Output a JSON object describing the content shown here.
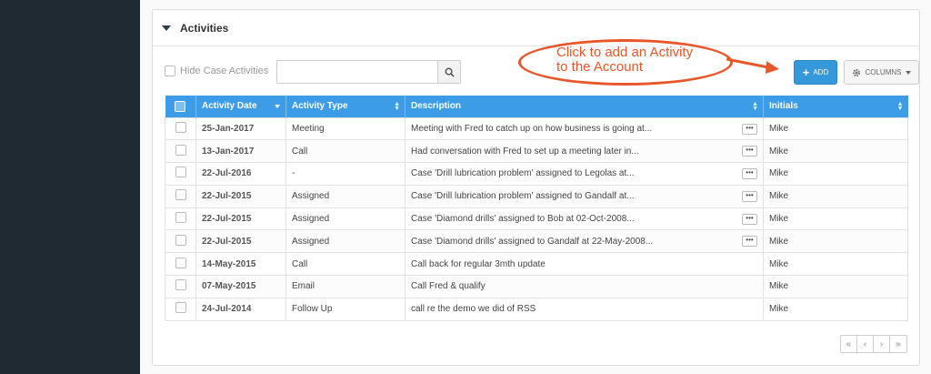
{
  "panel": {
    "title": "Activities"
  },
  "toolbar": {
    "hide_label": "Hide Case Activities",
    "search_placeholder": "",
    "add_label": "ADD",
    "columns_label": "COLUMNS"
  },
  "annotation": {
    "line1": "Click to add an Activity",
    "line2": "to the Account"
  },
  "table": {
    "headers": [
      "Activity Date",
      "Activity Type",
      "Description",
      "Initials"
    ],
    "rows": [
      {
        "date": "25-Jan-2017",
        "type": "Meeting",
        "description": "Meeting with Fred to catch up on how business is going at...",
        "initials": "Mike",
        "more": true
      },
      {
        "date": "13-Jan-2017",
        "type": "Call",
        "description": "Had conversation with Fred to set up a meeting later in...",
        "initials": "Mike",
        "more": true
      },
      {
        "date": "22-Jul-2016",
        "type": "-",
        "description": "Case 'Drill lubrication problem' assigned to Legolas at...",
        "initials": "Mike",
        "more": true
      },
      {
        "date": "22-Jul-2015",
        "type": "Assigned",
        "description": "Case 'Drill lubrication problem' assigned to Gandalf at...",
        "initials": "Mike",
        "more": true
      },
      {
        "date": "22-Jul-2015",
        "type": "Assigned",
        "description": "Case 'Diamond drills' assigned to Bob at 02-Oct-2008...",
        "initials": "Mike",
        "more": true
      },
      {
        "date": "22-Jul-2015",
        "type": "Assigned",
        "description": "Case 'Diamond drills' assigned to Gandalf at 22-May-2008...",
        "initials": "Mike",
        "more": true
      },
      {
        "date": "14-May-2015",
        "type": "Call",
        "description": "Call back for regular 3mth update",
        "initials": "Mike",
        "more": false
      },
      {
        "date": "07-May-2015",
        "type": "Email",
        "description": "Call Fred & qualify",
        "initials": "Mike",
        "more": false
      },
      {
        "date": "24-Jul-2014",
        "type": "Follow Up",
        "description": "call re the demo we did of RSS",
        "initials": "Mike",
        "more": false
      }
    ]
  },
  "pager": {
    "first": "«",
    "prev": "‹",
    "next": "›",
    "last": "»"
  },
  "colors": {
    "header_blue": "#3d9ce8",
    "add_blue": "#3498db",
    "callout_orange": "#e8572a",
    "nav_dark": "#1f2a33"
  }
}
